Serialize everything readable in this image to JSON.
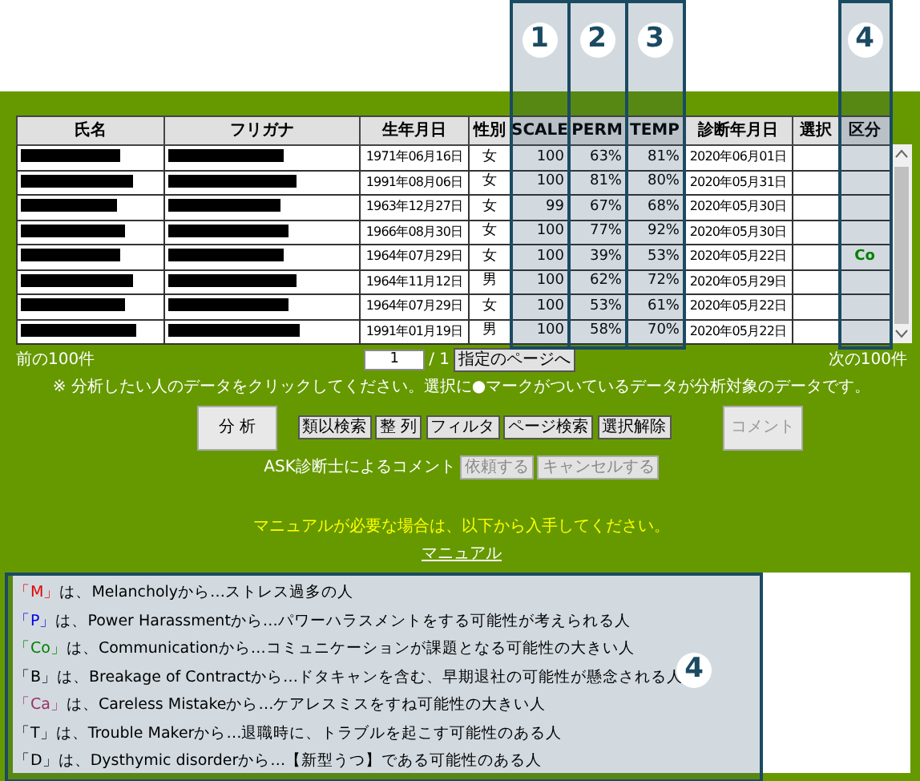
{
  "table": {
    "columns": [
      {
        "label": "氏名"
      },
      {
        "label": "フリガナ"
      },
      {
        "label": "生年月日"
      },
      {
        "label": "性別"
      },
      {
        "label": "SCALE",
        "callout": "1"
      },
      {
        "label": "PERM",
        "callout": "2"
      },
      {
        "label": "TEMP",
        "callout": "3"
      },
      {
        "label": "診断年月日"
      },
      {
        "label": "選択"
      },
      {
        "label": "区分",
        "callout": "4"
      }
    ],
    "rows": [
      {
        "birth_date": "1971年06月16日",
        "sex": "女",
        "scale": "100",
        "perm": "63%",
        "temp": "81%",
        "diagnosis_date": "2020年06月01日"
      },
      {
        "birth_date": "1991年08月06日",
        "sex": "女",
        "scale": "100",
        "perm": "81%",
        "temp": "80%",
        "diagnosis_date": "2020年05月31日"
      },
      {
        "birth_date": "1963年12月27日",
        "sex": "女",
        "scale": "99",
        "perm": "67%",
        "temp": "68%",
        "diagnosis_date": "2020年05月30日"
      },
      {
        "birth_date": "1966年08月30日",
        "sex": "女",
        "scale": "100",
        "perm": "77%",
        "temp": "92%",
        "diagnosis_date": "2020年05月30日"
      },
      {
        "birth_date": "1964年07月29日",
        "sex": "女",
        "scale": "100",
        "perm": "39%",
        "temp": "53%",
        "diagnosis_date": "2020年05月22日",
        "category": "Co",
        "color": "#008000"
      },
      {
        "birth_date": "1964年11月12日",
        "sex": "男",
        "scale": "100",
        "perm": "62%",
        "temp": "72%",
        "diagnosis_date": "2020年05月29日"
      },
      {
        "birth_date": "1964年07月29日",
        "sex": "女",
        "scale": "100",
        "perm": "53%",
        "temp": "61%",
        "diagnosis_date": "2020年05月22日"
      },
      {
        "birth_date": "1991年01月19日",
        "sex": "男",
        "scale": "100",
        "perm": "58%",
        "temp": "70%",
        "diagnosis_date": "2020年05月22日"
      }
    ]
  },
  "pager": {
    "prev": "前の100件",
    "page": "1",
    "total": "/ 1",
    "go_button": "指定のページへ",
    "next": "次の100件"
  },
  "notice": "※ 分析したい人のデータをクリックしてください。選択に●マークがついているデータが分析対象のデータです。",
  "buttons": [
    {
      "label": "分 析",
      "kind": "large",
      "disabled": false
    },
    {
      "label": "類以検索",
      "kind": "small",
      "disabled": false
    },
    {
      "label": "整 列",
      "kind": "small",
      "disabled": false
    },
    {
      "label": "フィルタ",
      "kind": "small",
      "disabled": false
    },
    {
      "label": "ページ検索",
      "kind": "small",
      "disabled": false
    },
    {
      "label": "選択解除",
      "kind": "small",
      "disabled": false
    },
    {
      "label": "コメント",
      "kind": "large",
      "disabled": true
    }
  ],
  "comment_request": {
    "label": "ASK診断士によるコメント",
    "buttons": [
      {
        "label": "依頼する",
        "disabled": true
      },
      {
        "label": "キャンセルする",
        "disabled": true
      }
    ]
  },
  "manual": {
    "notice": "マニュアルが必要な場合は、以下から入手してください。",
    "link": "マニュアル"
  },
  "legend": {
    "callout": "4",
    "items": [
      {
        "code": "「M」",
        "color": "#e00000",
        "text": "は、Melancholyから…ストレス過多の人"
      },
      {
        "code": "「P」",
        "color": "#0000e0",
        "text": "は、Power Harassmentから…パワーハラスメントをする可能性が考えられる人"
      },
      {
        "code": "「Co」",
        "color": "#008000",
        "text": "は、Communicationから…コミュニケーションが課題となる可能性の大きい人"
      },
      {
        "code": "「B」",
        "color": "#000000",
        "text": "は、Breakage of Contractから…ドタキャンを含む、早期退社の可能性が懸念される人"
      },
      {
        "code": "「Ca」",
        "color": "#993366",
        "text": "は、Careless Mistakeから…ケアレスミスをすね可能性の大きい人"
      },
      {
        "code": "「T」",
        "color": "#000000",
        "text": "は、Trouble Makerから…退職時に、トラブルを起こす可能性のある人"
      },
      {
        "code": "「D」",
        "color": "#000000",
        "text": "は、Dysthymic disorderから…【新型うつ】である可能性のある人"
      }
    ]
  }
}
